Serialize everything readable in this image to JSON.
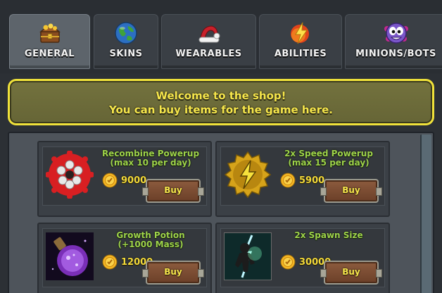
{
  "tabs": [
    {
      "label": "GENERAL",
      "icon": "treasure-chest-icon",
      "active": true
    },
    {
      "label": "SKINS",
      "icon": "globe-icon",
      "active": false
    },
    {
      "label": "WEARABLES",
      "icon": "santa-hat-icon",
      "active": false
    },
    {
      "label": "ABILITIES",
      "icon": "lightning-bolt-icon",
      "active": false
    },
    {
      "label": "MINIONS/BOTS",
      "icon": "minion-face-icon",
      "active": false
    }
  ],
  "banner": {
    "line1": "Welcome to the shop!",
    "line2": "You can buy items for the game here."
  },
  "items": [
    {
      "name_line1": "Recombine Powerup",
      "name_line2": "(max 10 per day)",
      "price": "9000",
      "buy_label": "Buy",
      "icon": "recombine-molecule-icon"
    },
    {
      "name_line1": "2x Speed Powerup",
      "name_line2": "(max 15 per day)",
      "price": "5900",
      "buy_label": "Buy",
      "icon": "lightning-badge-icon"
    },
    {
      "name_line1": "Growth Potion",
      "name_line2": "(+1000 Mass)",
      "price": "12000",
      "buy_label": "Buy",
      "icon": "purple-potion-icon"
    },
    {
      "name_line1": "2x Spawn Size",
      "name_line2": "",
      "price": "30000",
      "buy_label": "Buy",
      "icon": "spawn-figure-icon"
    }
  ],
  "colors": {
    "accent_yellow": "#f6e64b",
    "item_name_green": "#9ed34a",
    "price_gold": "#f2d93a",
    "banner_border": "#f0e23a"
  }
}
